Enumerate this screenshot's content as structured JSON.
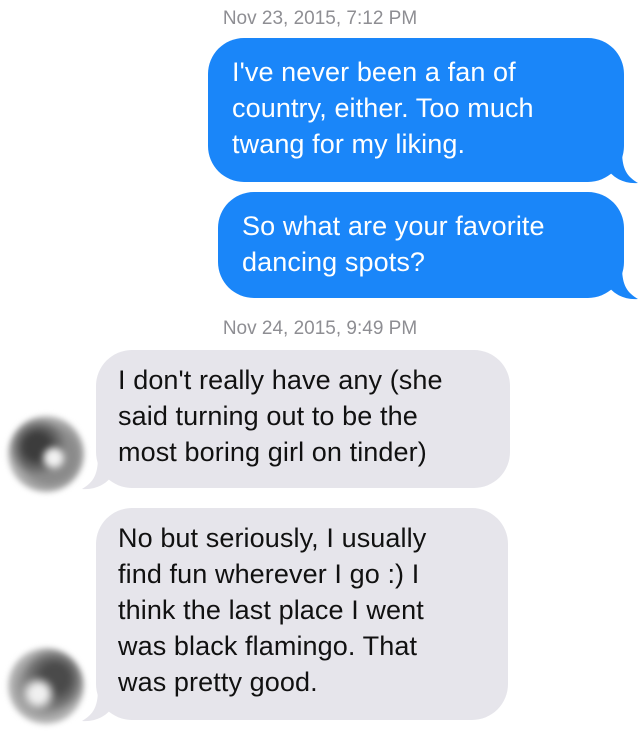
{
  "conversation": {
    "timestamps": [
      "Nov 23, 2015, 7:12 PM",
      "Nov 24, 2015, 9:49 PM"
    ],
    "messages": [
      {
        "direction": "outgoing",
        "text": "I've never been a fan of\ncountry, either. Too much\ntwang for my liking."
      },
      {
        "direction": "outgoing",
        "text": "So what are your favorite\ndancing spots?"
      },
      {
        "direction": "incoming",
        "text": "I don't really have any (she\nsaid turning out to be the\nmost boring girl on tinder)"
      },
      {
        "direction": "incoming",
        "text": "No but seriously, I usually\nfind fun wherever I go :) I\nthink the last place I went\nwas black flamingo. That\nwas pretty good."
      }
    ]
  },
  "colors": {
    "outgoing_bubble": "#1a86f9",
    "incoming_bubble": "#e6e5eb",
    "timestamp_text": "#8e8e93"
  },
  "icons": {
    "contact_avatar": "blurred-avatar-icon"
  }
}
